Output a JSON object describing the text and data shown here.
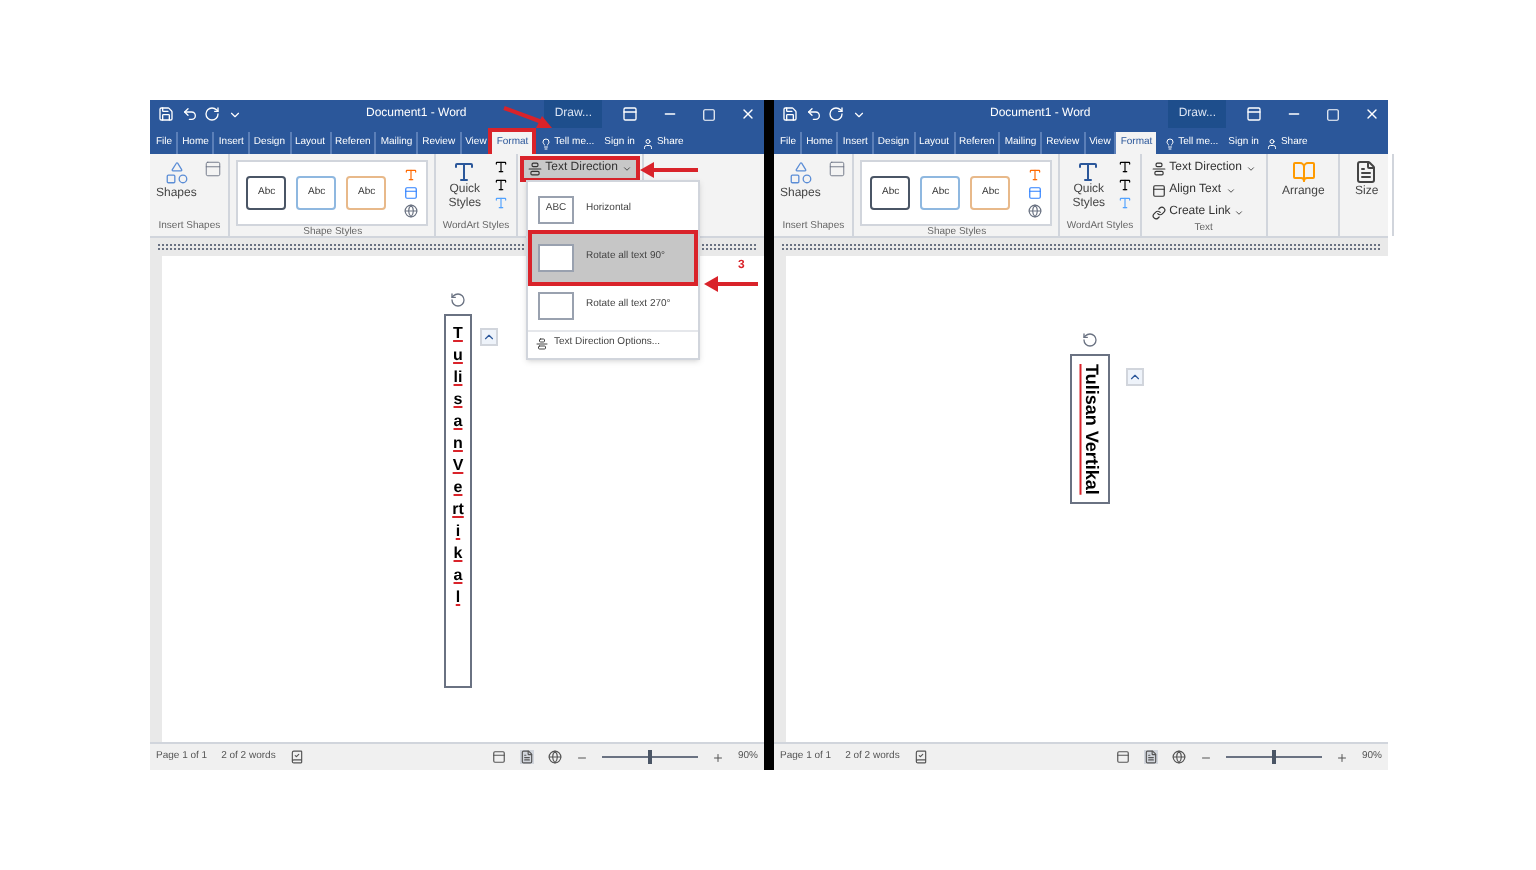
{
  "windows": [
    {
      "title": "Document1 - Word",
      "contextual": "Draw...",
      "tabs": [
        {
          "label": "File",
          "selected": false,
          "highlighted": false
        },
        {
          "label": "Home",
          "selected": false,
          "highlighted": false
        },
        {
          "label": "Insert",
          "selected": false,
          "highlighted": false
        },
        {
          "label": "Design",
          "selected": false,
          "highlighted": false
        },
        {
          "label": "Layout",
          "selected": false,
          "highlighted": false
        },
        {
          "label": "Referen",
          "selected": false,
          "highlighted": false
        },
        {
          "label": "Mailing",
          "selected": false,
          "highlighted": false
        },
        {
          "label": "Review",
          "selected": false,
          "highlighted": false
        },
        {
          "label": "View",
          "selected": false,
          "highlighted": false
        },
        {
          "label": "Format",
          "selected": true,
          "highlighted": true
        }
      ],
      "tell_me": "Tell me...",
      "sign_in": "Sign in",
      "share": "Share",
      "groups": [
        {
          "kind": "shapes",
          "button": "Shapes",
          "label": "Insert Shapes"
        },
        {
          "kind": "styles",
          "styles": [
            "Abc",
            "Abc",
            "Abc"
          ],
          "label": "Shape Styles"
        },
        {
          "kind": "wordart",
          "button": "Quick Styles",
          "label": "WordArt Styles"
        },
        {
          "kind": "text",
          "items": [
            {
              "label": "Text Direction",
              "highlighted": true
            }
          ]
        }
      ],
      "menu": {
        "items": [
          {
            "kind": "option",
            "preview": "ABC",
            "label": "Horizontal",
            "selected": false,
            "highlighted": false
          },
          {
            "kind": "option",
            "label": "Rotate all text 90°",
            "selected": true,
            "highlighted": true,
            "callout": "3"
          },
          {
            "kind": "option",
            "label": "Rotate all text 270°",
            "selected": false,
            "highlighted": false
          },
          {
            "kind": "link",
            "label": "Text Direction Options..."
          }
        ]
      },
      "document": {
        "text": "Tulisan Vertikal",
        "kind": "stacked"
      },
      "status": {
        "page": "Page 1 of 1",
        "words": "2 of 2 words",
        "zoom": "90%",
        "level": 0.5
      }
    },
    {
      "title": "Document1 - Word",
      "contextual": "Draw...",
      "tabs": [
        {
          "label": "File",
          "selected": false,
          "highlighted": false
        },
        {
          "label": "Home",
          "selected": false,
          "highlighted": false
        },
        {
          "label": "Insert",
          "selected": false,
          "highlighted": false
        },
        {
          "label": "Design",
          "selected": false,
          "highlighted": false
        },
        {
          "label": "Layout",
          "selected": false,
          "highlighted": false
        },
        {
          "label": "Referen",
          "selected": false,
          "highlighted": false
        },
        {
          "label": "Mailing",
          "selected": false,
          "highlighted": false
        },
        {
          "label": "Review",
          "selected": false,
          "highlighted": false
        },
        {
          "label": "View",
          "selected": false,
          "highlighted": false
        },
        {
          "label": "Format",
          "selected": true,
          "highlighted": false
        }
      ],
      "tell_me": "Tell me...",
      "sign_in": "Sign in",
      "share": "Share",
      "groups": [
        {
          "kind": "shapes",
          "button": "Shapes",
          "label": "Insert Shapes"
        },
        {
          "kind": "styles",
          "styles": [
            "Abc",
            "Abc",
            "Abc"
          ],
          "label": "Shape Styles"
        },
        {
          "kind": "wordart",
          "button": "Quick Styles",
          "label": "WordArt Styles"
        },
        {
          "kind": "text",
          "items": [
            {
              "label": "Text Direction",
              "highlighted": false
            },
            {
              "label": "Align Text",
              "highlighted": false
            },
            {
              "label": "Create Link",
              "highlighted": false
            }
          ],
          "label": "Text"
        },
        {
          "kind": "big",
          "button": "Arrange"
        },
        {
          "kind": "big",
          "button": "Size"
        }
      ],
      "document": {
        "text": "Tulisan Vertikal",
        "kind": "rotated"
      },
      "status": {
        "page": "Page 1 of 1",
        "words": "2 of 2 words",
        "zoom": "90%",
        "level": 0.5
      }
    }
  ]
}
